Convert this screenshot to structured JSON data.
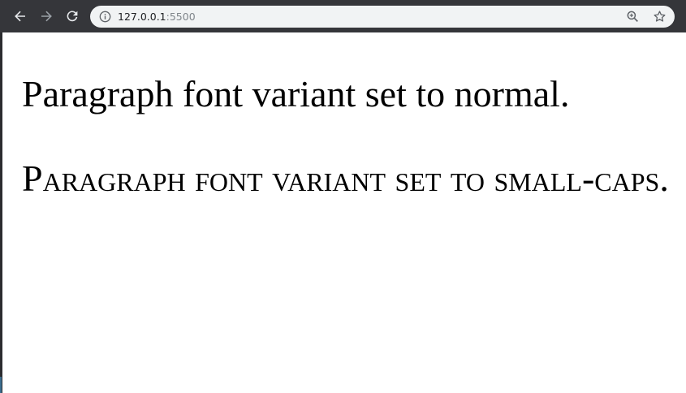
{
  "browser": {
    "url_host": "127.0.0.1",
    "url_port": ":5500",
    "icons": {
      "back": "back-arrow-icon",
      "forward": "forward-arrow-icon",
      "reload": "reload-icon",
      "site_info": "info-icon",
      "zoom": "zoom-icon",
      "bookmark": "star-icon"
    },
    "colors": {
      "toolbar": "#35363a",
      "omnibox": "#f1f3f4",
      "page_background": "#ffffff"
    }
  },
  "page": {
    "paragraphs": [
      {
        "text": "Paragraph font variant set to normal.",
        "font_variant": "normal"
      },
      {
        "text": "Paragraph font variant set to small-caps.",
        "font_variant": "small-caps"
      }
    ]
  }
}
